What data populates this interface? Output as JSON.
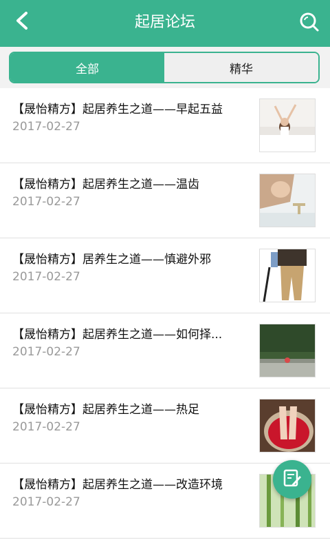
{
  "header": {
    "title": "起居论坛",
    "back_icon": "chevron-left-icon",
    "search_icon": "search-icon",
    "accent_color": "#3ab38f"
  },
  "tabs": [
    {
      "label": "全部",
      "active": true
    },
    {
      "label": "精华",
      "active": false
    }
  ],
  "posts": [
    {
      "title": "【晟怡精方】起居养生之道——早起五益",
      "date": "2017-02-27",
      "thumb": "woman-waking-up-photo"
    },
    {
      "title": "【晟怡精方】起居养生之道——温齿",
      "date": "2017-02-27",
      "thumb": "woman-at-sink-photo"
    },
    {
      "title": "【晟怡精方】居养生之道——慎避外邪",
      "date": "2017-02-27",
      "thumb": "elderly-with-cane-photo"
    },
    {
      "title": "【晟怡精方】起居养生之道——如何择...",
      "date": "2017-02-27",
      "thumb": "park-path-photo"
    },
    {
      "title": "【晟怡精方】起居养生之道——热足",
      "date": "2017-02-27",
      "thumb": "foot-soak-roses-photo"
    },
    {
      "title": "【晟怡精方】起居养生之道——改造环境",
      "date": "2017-02-27",
      "thumb": "bamboo-photo"
    }
  ],
  "fab": {
    "icon": "compose-icon"
  }
}
